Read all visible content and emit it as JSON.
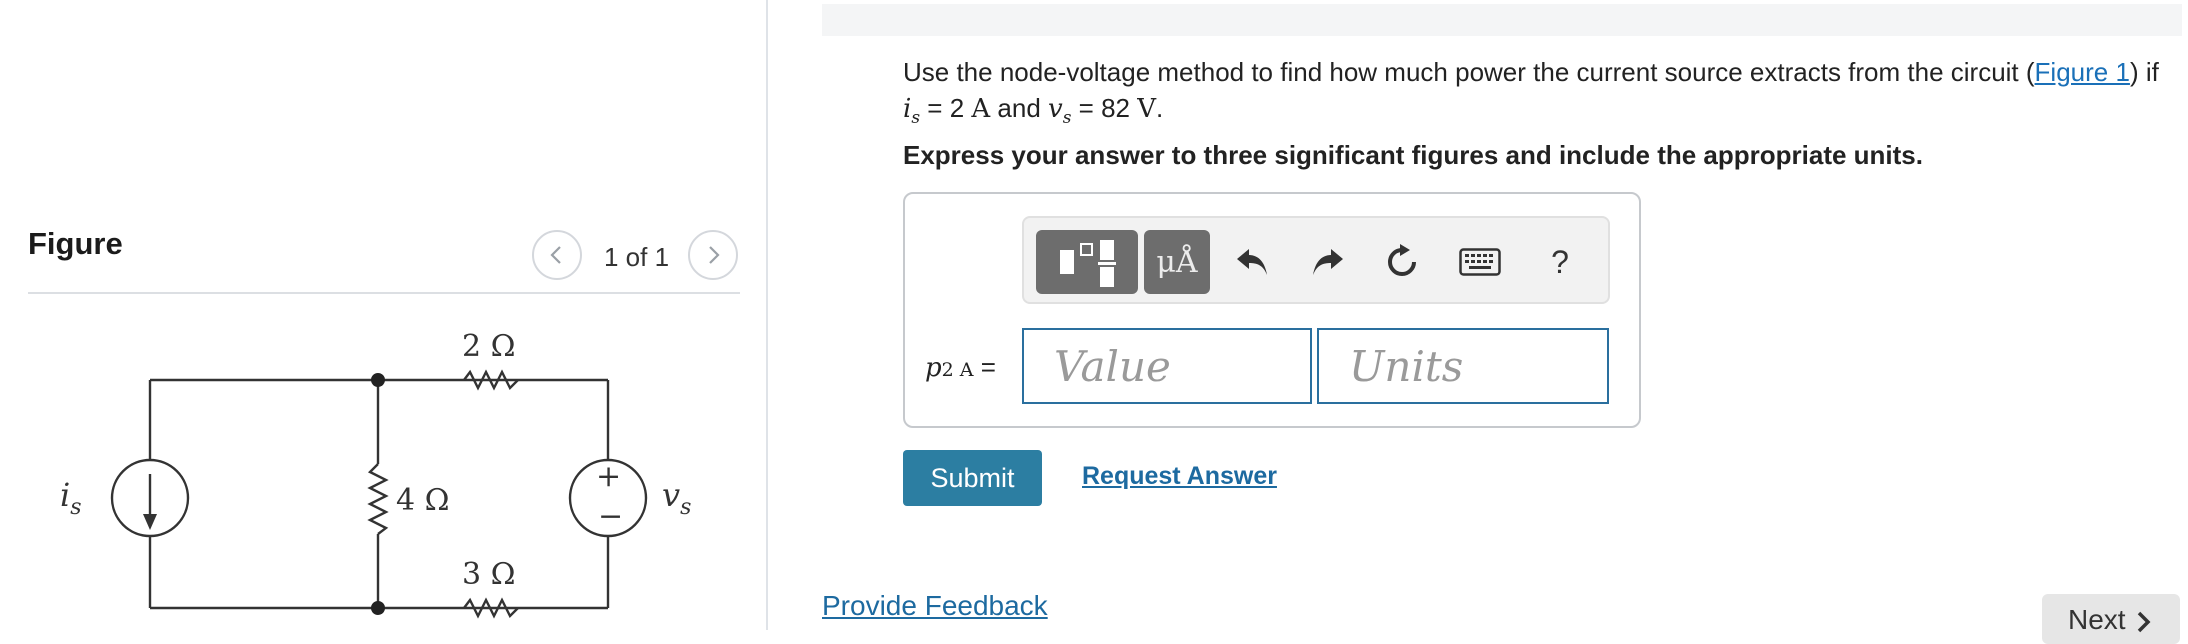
{
  "figure_panel": {
    "title": "Figure",
    "pager_label": "1 of 1",
    "circuit_labels": {
      "r_top": "2 Ω",
      "r_mid": "4 Ω",
      "r_bottom": "3 Ω",
      "current_source": "i",
      "current_source_sub": "s",
      "voltage_source": "v",
      "voltage_source_sub": "s",
      "plus": "+",
      "minus": "−"
    }
  },
  "question": {
    "text_before_link": "Use the node-voltage method to find how much power the current source extracts from the circuit (",
    "link_text": "Figure 1",
    "text_after_link": ") if",
    "is_var": "i",
    "is_sub": "s",
    "is_value": " = 2 ",
    "is_unit": "A",
    "and_text": " and ",
    "vs_var": "v",
    "vs_sub": "s",
    "vs_value": " = 82 ",
    "vs_unit": "V",
    "period": ".",
    "instruction": "Express your answer to three significant figures and include the appropriate units."
  },
  "answer": {
    "toolbar": {
      "units_label": "μÅ",
      "help_label": "?"
    },
    "label_var": "p",
    "label_sub": "2 A",
    "label_eq": " =",
    "value_placeholder": "Value",
    "units_placeholder": "Units"
  },
  "actions": {
    "submit_label": "Submit",
    "request_label": "Request Answer",
    "feedback_label": "Provide Feedback",
    "next_label": "Next"
  },
  "colors": {
    "link": "#1d6aa0",
    "submit_bg": "#2c7ea2",
    "input_border": "#2a6f9e",
    "toolbar_dark": "#6d6d6d"
  }
}
